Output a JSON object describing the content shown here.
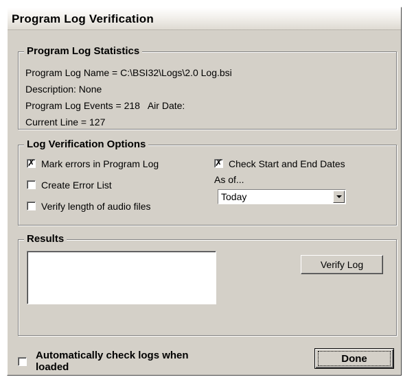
{
  "window": {
    "title": "Program Log Verification"
  },
  "stats": {
    "legend": "Program Log Statistics",
    "name_line": "Program Log Name = C:\\BSI32\\Logs\\2.0 Log.bsi",
    "description_line": "Description: None",
    "events_line": "Program Log Events = 218   Air Date:",
    "current_line": "Current Line = 127"
  },
  "options": {
    "legend": "Log Verification Options",
    "mark_errors": {
      "label": "Mark errors in Program Log",
      "checked": true
    },
    "create_error_list": {
      "label": "Create Error List",
      "checked": false
    },
    "verify_audio_length": {
      "label": "Verify length of audio files",
      "checked": false
    },
    "check_dates": {
      "label": "Check Start and End Dates",
      "checked": true
    },
    "as_of_label": "As of...",
    "as_of_value": "Today"
  },
  "results": {
    "legend": "Results",
    "verify_button": "Verify Log"
  },
  "footer": {
    "auto_check": {
      "label_line1": "Automatically check logs when",
      "label_line2": "loaded",
      "checked": false
    },
    "done_button": "Done"
  },
  "icons": {
    "check_mark": "✗"
  }
}
